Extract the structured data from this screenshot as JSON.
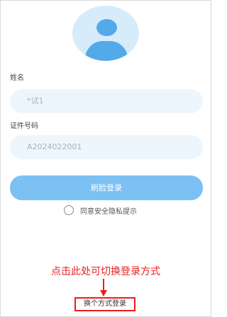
{
  "profile": {
    "avatar_icon": "user-avatar-icon"
  },
  "form": {
    "name_label": "姓名",
    "name_value": "*试1",
    "id_label": "证件号码",
    "id_value": "A2024022001"
  },
  "actions": {
    "face_login_label": "刷脸登录",
    "agree_label": "同意安全隐私提示"
  },
  "annotation": {
    "hint_text": "点击此处可切换登录方式",
    "arrow_icon": "arrow-down-icon"
  },
  "switch_login_label": "换个方式登录",
  "colors": {
    "accent": "#7dc0f3",
    "field_bg": "#eef6fd",
    "annotation": "#e81e1e"
  }
}
